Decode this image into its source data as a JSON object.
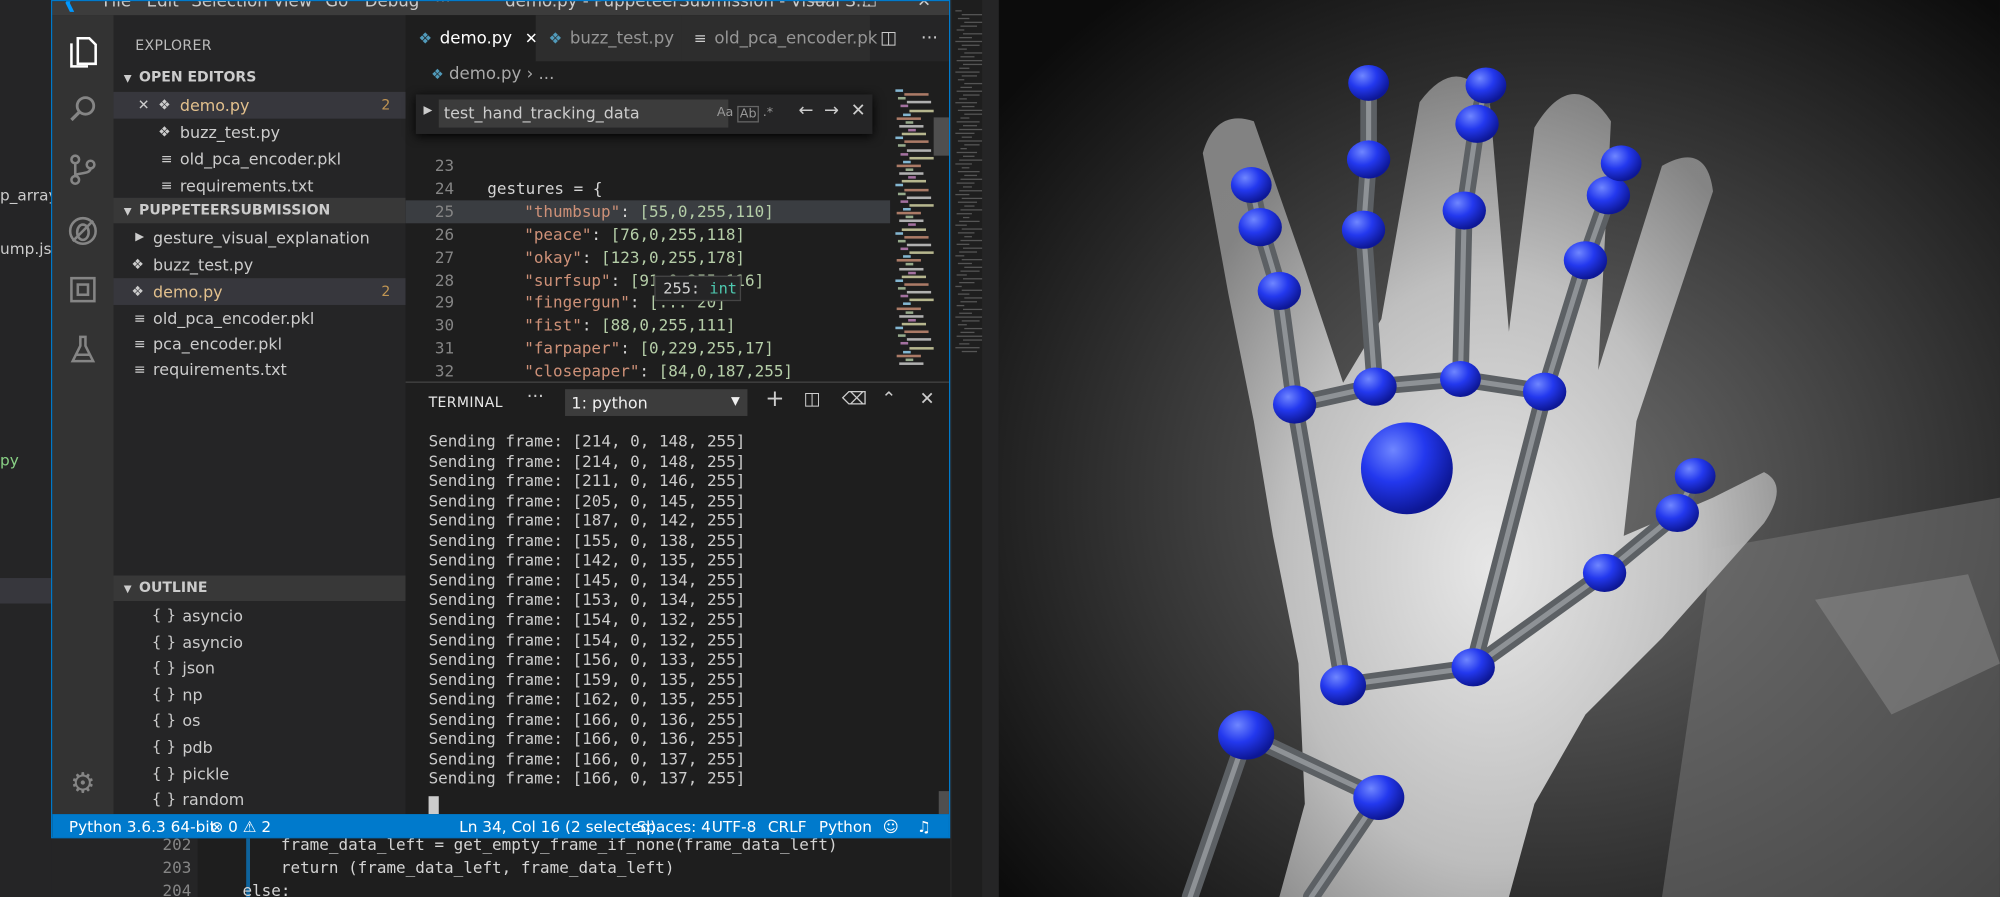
{
  "window": {
    "title": "demo.py - PuppeteerSubmission - Visual S...",
    "menu": [
      "File",
      "Edit",
      "Selection",
      "View",
      "Go",
      "Debug",
      "···"
    ]
  },
  "background": {
    "left_fragments": [
      "p_array.",
      "ump.jso",
      "py"
    ],
    "bottom_lines": [
      {
        "num": "202",
        "code": "        frame_data_left = get_empty_frame_if_none(frame_data_left)"
      },
      {
        "num": "203",
        "code": "        return (frame_data_left, frame_data_left)"
      },
      {
        "num": "204",
        "code": "    else:"
      }
    ]
  },
  "sidebar": {
    "header": "EXPLORER",
    "open_editors": {
      "title": "OPEN EDITORS",
      "items": [
        {
          "label": "demo.py",
          "badge": "2"
        },
        {
          "label": "buzz_test.py"
        },
        {
          "label": "old_pca_encoder.pkl"
        },
        {
          "label": "requirements.txt"
        }
      ]
    },
    "project": {
      "title": "PUPPETEERSUBMISSION",
      "items": [
        {
          "label": "gesture_visual_explanation"
        },
        {
          "label": "buzz_test.py"
        },
        {
          "label": "demo.py",
          "badge": "2"
        },
        {
          "label": "old_pca_encoder.pkl"
        },
        {
          "label": "pca_encoder.pkl"
        },
        {
          "label": "requirements.txt"
        }
      ]
    },
    "outline": {
      "title": "OUTLINE",
      "items": [
        "asyncio",
        "asyncio",
        "json",
        "np",
        "os",
        "pdb",
        "pickle",
        "random"
      ]
    }
  },
  "tabs": [
    {
      "label": "demo.py",
      "active": true
    },
    {
      "label": "buzz_test.py"
    },
    {
      "label": "old_pca_encoder.pk"
    }
  ],
  "breadcrumb": {
    "file": "demo.py",
    "rest": "..."
  },
  "find": {
    "value": "test_hand_tracking_data",
    "opt_case": "Aa",
    "opt_word": "Ab",
    "opt_regex": ".*"
  },
  "code": {
    "lines": [
      {
        "num": "23",
        "html": ""
      },
      {
        "num": "24",
        "html": "gestures = {"
      },
      {
        "num": "25",
        "key": "\"thumbsup\"",
        "vals": "[55,0,255,110]"
      },
      {
        "num": "26",
        "key": "\"peace\"",
        "vals": "[76,0,255,118]"
      },
      {
        "num": "27",
        "key": "\"okay\"",
        "vals": "[123,0,255,178]"
      },
      {
        "num": "28",
        "key": "\"surfsup\"",
        "vals": "[91,0,255,116]"
      },
      {
        "num": "29",
        "key": "\"fingergun\"",
        "vals": "[... 20]"
      },
      {
        "num": "30",
        "key": "\"fist\"",
        "vals": "[88,0,255,111]"
      },
      {
        "num": "31",
        "key": "\"farpaper\"",
        "vals": "[0,229,255,17]"
      },
      {
        "num": "32",
        "key": "\"closepaper\"",
        "vals": "[84,0,187,255]"
      }
    ],
    "hover": {
      "value": "255:",
      "type": "int"
    }
  },
  "panel": {
    "title": "TERMINAL",
    "terminal_select": "1: python",
    "lines": [
      "Sending frame: [214, 0, 148, 255]",
      "Sending frame: [214, 0, 148, 255]",
      "Sending frame: [211, 0, 146, 255]",
      "Sending frame: [205, 0, 145, 255]",
      "Sending frame: [187, 0, 142, 255]",
      "Sending frame: [155, 0, 138, 255]",
      "Sending frame: [142, 0, 135, 255]",
      "Sending frame: [145, 0, 134, 255]",
      "Sending frame: [153, 0, 134, 255]",
      "Sending frame: [154, 0, 132, 255]",
      "Sending frame: [154, 0, 132, 255]",
      "Sending frame: [156, 0, 133, 255]",
      "Sending frame: [159, 0, 135, 255]",
      "Sending frame: [162, 0, 135, 255]",
      "Sending frame: [166, 0, 136, 255]",
      "Sending frame: [166, 0, 136, 255]",
      "Sending frame: [166, 0, 137, 255]",
      "Sending frame: [166, 0, 137, 255]"
    ]
  },
  "status": {
    "interpreter": "Python 3.6.3 64-bit",
    "errors": "0",
    "warnings": "2",
    "position": "Ln 34, Col 16 (2 selected)",
    "spaces": "Spaces: 4",
    "encoding": "UTF-8",
    "eol": "CRLF",
    "language": "Python"
  },
  "colors": {
    "accent": "#007acc",
    "joint": "#1f3cf0",
    "bone": "#5a5e62"
  }
}
